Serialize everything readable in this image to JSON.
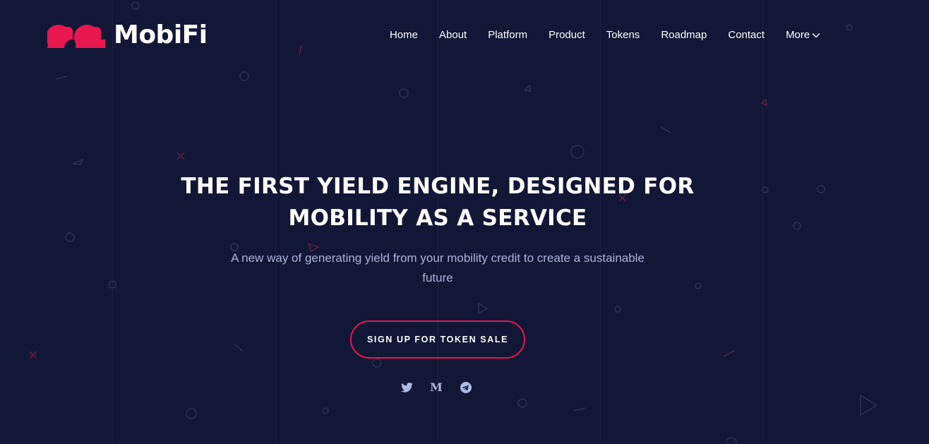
{
  "brand": {
    "name": "MobiFi",
    "logo_icon": "mobifi-logo-icon",
    "accent_color": "#e8174f"
  },
  "nav": {
    "items": [
      {
        "label": "Home"
      },
      {
        "label": "About"
      },
      {
        "label": "Platform"
      },
      {
        "label": "Product"
      },
      {
        "label": "Tokens"
      },
      {
        "label": "Roadmap"
      },
      {
        "label": "Contact"
      }
    ],
    "more_label": "More",
    "more_icon": "chevron-down-icon"
  },
  "hero": {
    "title_line1": "THE FIRST YIELD ENGINE, DESIGNED FOR",
    "title_line2": "MOBILITY AS A SERVICE",
    "subtitle": "A new way of generating yield from your mobility credit to create a sustainable future",
    "cta_label": "SIGN UP FOR TOKEN SALE"
  },
  "socials": [
    {
      "icon": "twitter-icon"
    },
    {
      "icon": "medium-icon"
    },
    {
      "icon": "telegram-icon"
    }
  ],
  "colors": {
    "background": "#111735",
    "subtitle": "#a9b4dd",
    "icon": "#aeb9e3"
  }
}
